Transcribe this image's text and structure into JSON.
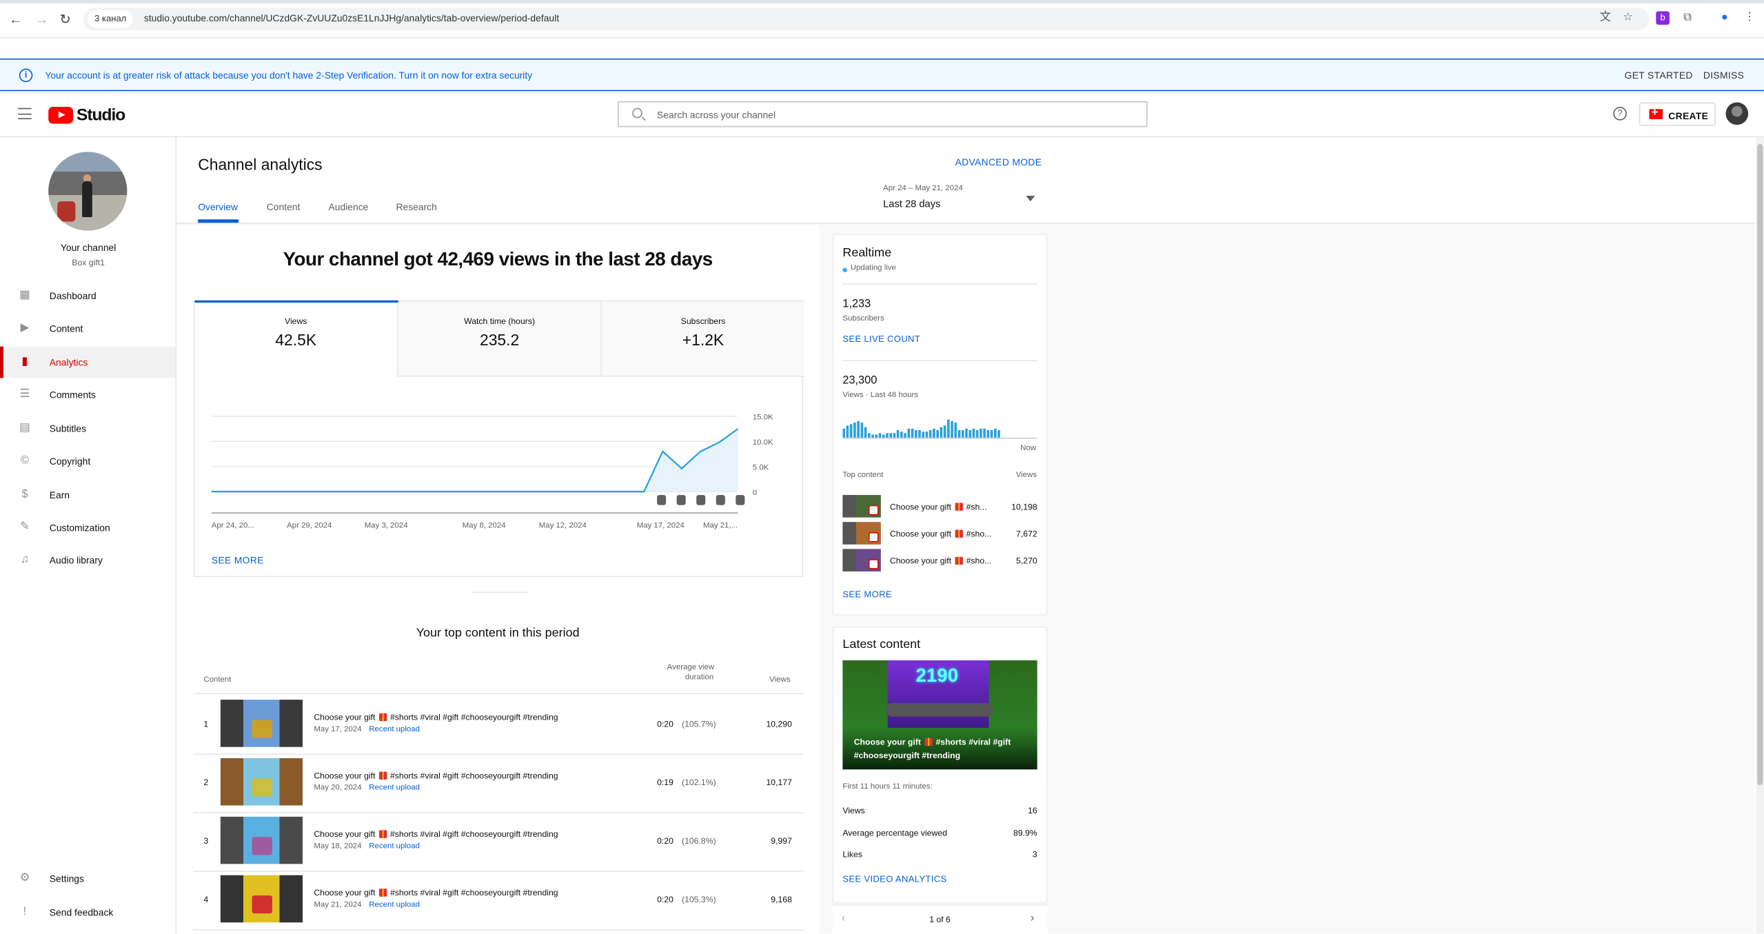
{
  "browser": {
    "tab_chip": "3 канал",
    "url": "studio.youtube.com/channel/UCzdGK-ZvUUZu0zsE1LnJJHg/analytics/tab-overview/period-default"
  },
  "banner": {
    "message": "Your account is at greater risk of attack because you don't have 2-Step Verification. Turn it on now for extra security",
    "get_started": "GET STARTED",
    "dismiss": "DISMISS"
  },
  "header": {
    "logo_text": "Studio",
    "search_placeholder": "Search across your channel",
    "help": "?",
    "create": "CREATE"
  },
  "sidebar": {
    "your_channel": "Your channel",
    "channel_name": "Box gift1",
    "items": [
      {
        "label": "Dashboard",
        "icon": "dashboard-icon"
      },
      {
        "label": "Content",
        "icon": "content-icon"
      },
      {
        "label": "Analytics",
        "icon": "analytics-icon"
      },
      {
        "label": "Comments",
        "icon": "comments-icon"
      },
      {
        "label": "Subtitles",
        "icon": "subtitles-icon"
      },
      {
        "label": "Copyright",
        "icon": "copyright-icon"
      },
      {
        "label": "Earn",
        "icon": "earn-icon"
      },
      {
        "label": "Customization",
        "icon": "customization-icon"
      },
      {
        "label": "Audio library",
        "icon": "audio-library-icon"
      }
    ],
    "bottom": [
      {
        "label": "Settings",
        "icon": "gear-icon"
      },
      {
        "label": "Send feedback",
        "icon": "feedback-icon"
      }
    ]
  },
  "page": {
    "title": "Channel analytics",
    "advanced_mode": "ADVANCED MODE",
    "tabs": [
      "Overview",
      "Content",
      "Audience",
      "Research"
    ],
    "date_range": "Apr 24 – May 21, 2024",
    "date_label": "Last 28 days"
  },
  "overview": {
    "headline": "Your channel got 42,469 views in the last 28 days",
    "metrics": [
      {
        "title": "Views",
        "value": "42.5K"
      },
      {
        "title": "Watch time (hours)",
        "value": "235.2"
      },
      {
        "title": "Subscribers",
        "value": "+1.2K"
      }
    ],
    "see_more": "SEE MORE"
  },
  "chart_data": {
    "type": "line",
    "x_tick_labels": [
      "Apr 24, 20...",
      "Apr 29, 2024",
      "May 3, 2024",
      "May 8, 2024",
      "May 12, 2024",
      "May 17, 2024",
      "May 21,..."
    ],
    "y_tick_labels": [
      "15.0K",
      "10.0K",
      "5.0K",
      "0"
    ],
    "ylim": [
      0,
      15000
    ],
    "x": [
      "Apr 24",
      "Apr 25",
      "Apr 26",
      "Apr 27",
      "Apr 28",
      "Apr 29",
      "Apr 30",
      "May 1",
      "May 2",
      "May 3",
      "May 4",
      "May 5",
      "May 6",
      "May 7",
      "May 8",
      "May 9",
      "May 10",
      "May 11",
      "May 12",
      "May 13",
      "May 14",
      "May 15",
      "May 16",
      "May 17",
      "May 18",
      "May 19",
      "May 20",
      "May 21"
    ],
    "series": [
      {
        "values": [
          0,
          0,
          0,
          0,
          0,
          0,
          0,
          0,
          0,
          0,
          0,
          0,
          0,
          0,
          0,
          0,
          0,
          0,
          0,
          0,
          0,
          0,
          0,
          0,
          8000,
          4600,
          8000,
          9800,
          12500
        ]
      }
    ],
    "grid": true,
    "color": "#2ba1d9",
    "shorts_markers": 5
  },
  "top_content": {
    "title": "Your top content in this period",
    "headers": {
      "content": "Content",
      "avd_line1": "Average view",
      "avd_line2": "duration",
      "views": "Views"
    },
    "rows": [
      {
        "n": "1",
        "title_a": "Choose your gift",
        "title_b": "#shorts #viral #gift #chooseyourgift #trending",
        "date": "May 17, 2024",
        "recent": "Recent upload",
        "avd": "0:20",
        "pct": "(105.7%)",
        "views": "10,290"
      },
      {
        "n": "2",
        "title_a": "Choose your gift",
        "title_b": "#shorts #viral #gift #chooseyourgift #trending",
        "date": "May 20, 2024",
        "recent": "Recent upload",
        "avd": "0:19",
        "pct": "(102.1%)",
        "views": "10,177"
      },
      {
        "n": "3",
        "title_a": "Choose your gift",
        "title_b": "#shorts #viral #gift #chooseyourgift #trending",
        "date": "May 18, 2024",
        "recent": "Recent upload",
        "avd": "0:20",
        "pct": "(106.8%)",
        "views": "9,997"
      },
      {
        "n": "4",
        "title_a": "Choose your gift",
        "title_b": "#shorts #viral #gift #chooseyourgift #trending",
        "date": "May 21, 2024",
        "recent": "Recent upload",
        "avd": "0:20",
        "pct": "(105.3%)",
        "views": "9,168"
      }
    ]
  },
  "realtime": {
    "title": "Realtime",
    "updating": "Updating live",
    "subs_value": "1,233",
    "subs_label": "Subscribers",
    "see_live": "SEE LIVE COUNT",
    "views_value": "23,300",
    "views_label": "Views · Last 48 hours",
    "now": "Now",
    "bar_values": [
      6,
      8,
      9,
      10,
      11,
      10,
      7,
      3,
      2,
      2,
      3,
      2,
      3,
      3,
      3,
      5,
      4,
      3,
      6,
      6,
      5,
      5,
      4,
      4,
      5,
      6,
      5,
      7,
      8,
      12,
      11,
      10,
      5,
      5,
      6,
      5,
      6,
      5,
      6,
      6,
      5,
      5,
      6,
      5,
      0,
      0,
      0,
      0,
      0,
      0,
      0,
      0,
      0,
      0
    ],
    "top_content_label": "Top content",
    "views_col": "Views",
    "top": [
      {
        "title_a": "Choose your gift",
        "title_b": "#sh...",
        "views": "10,198"
      },
      {
        "title_a": "Choose your gift",
        "title_b": "#sho...",
        "views": "7,672"
      },
      {
        "title_a": "Choose your gift",
        "title_b": "#sho...",
        "views": "5,270"
      }
    ],
    "see_more": "SEE MORE"
  },
  "latest": {
    "title": "Latest content",
    "thumb_number": "2190",
    "thumb_caption_a": "Choose your gift",
    "thumb_caption_b": "#shorts #viral #gift",
    "thumb_caption_c": "#chooseyourgift #trending",
    "first_label": "First 11 hours 11 minutes:",
    "stats": [
      {
        "label": "Views",
        "value": "16"
      },
      {
        "label": "Average percentage viewed",
        "value": "89.9%"
      },
      {
        "label": "Likes",
        "value": "3"
      }
    ],
    "see_analytics": "SEE VIDEO ANALYTICS",
    "pager": "1 of 6"
  }
}
